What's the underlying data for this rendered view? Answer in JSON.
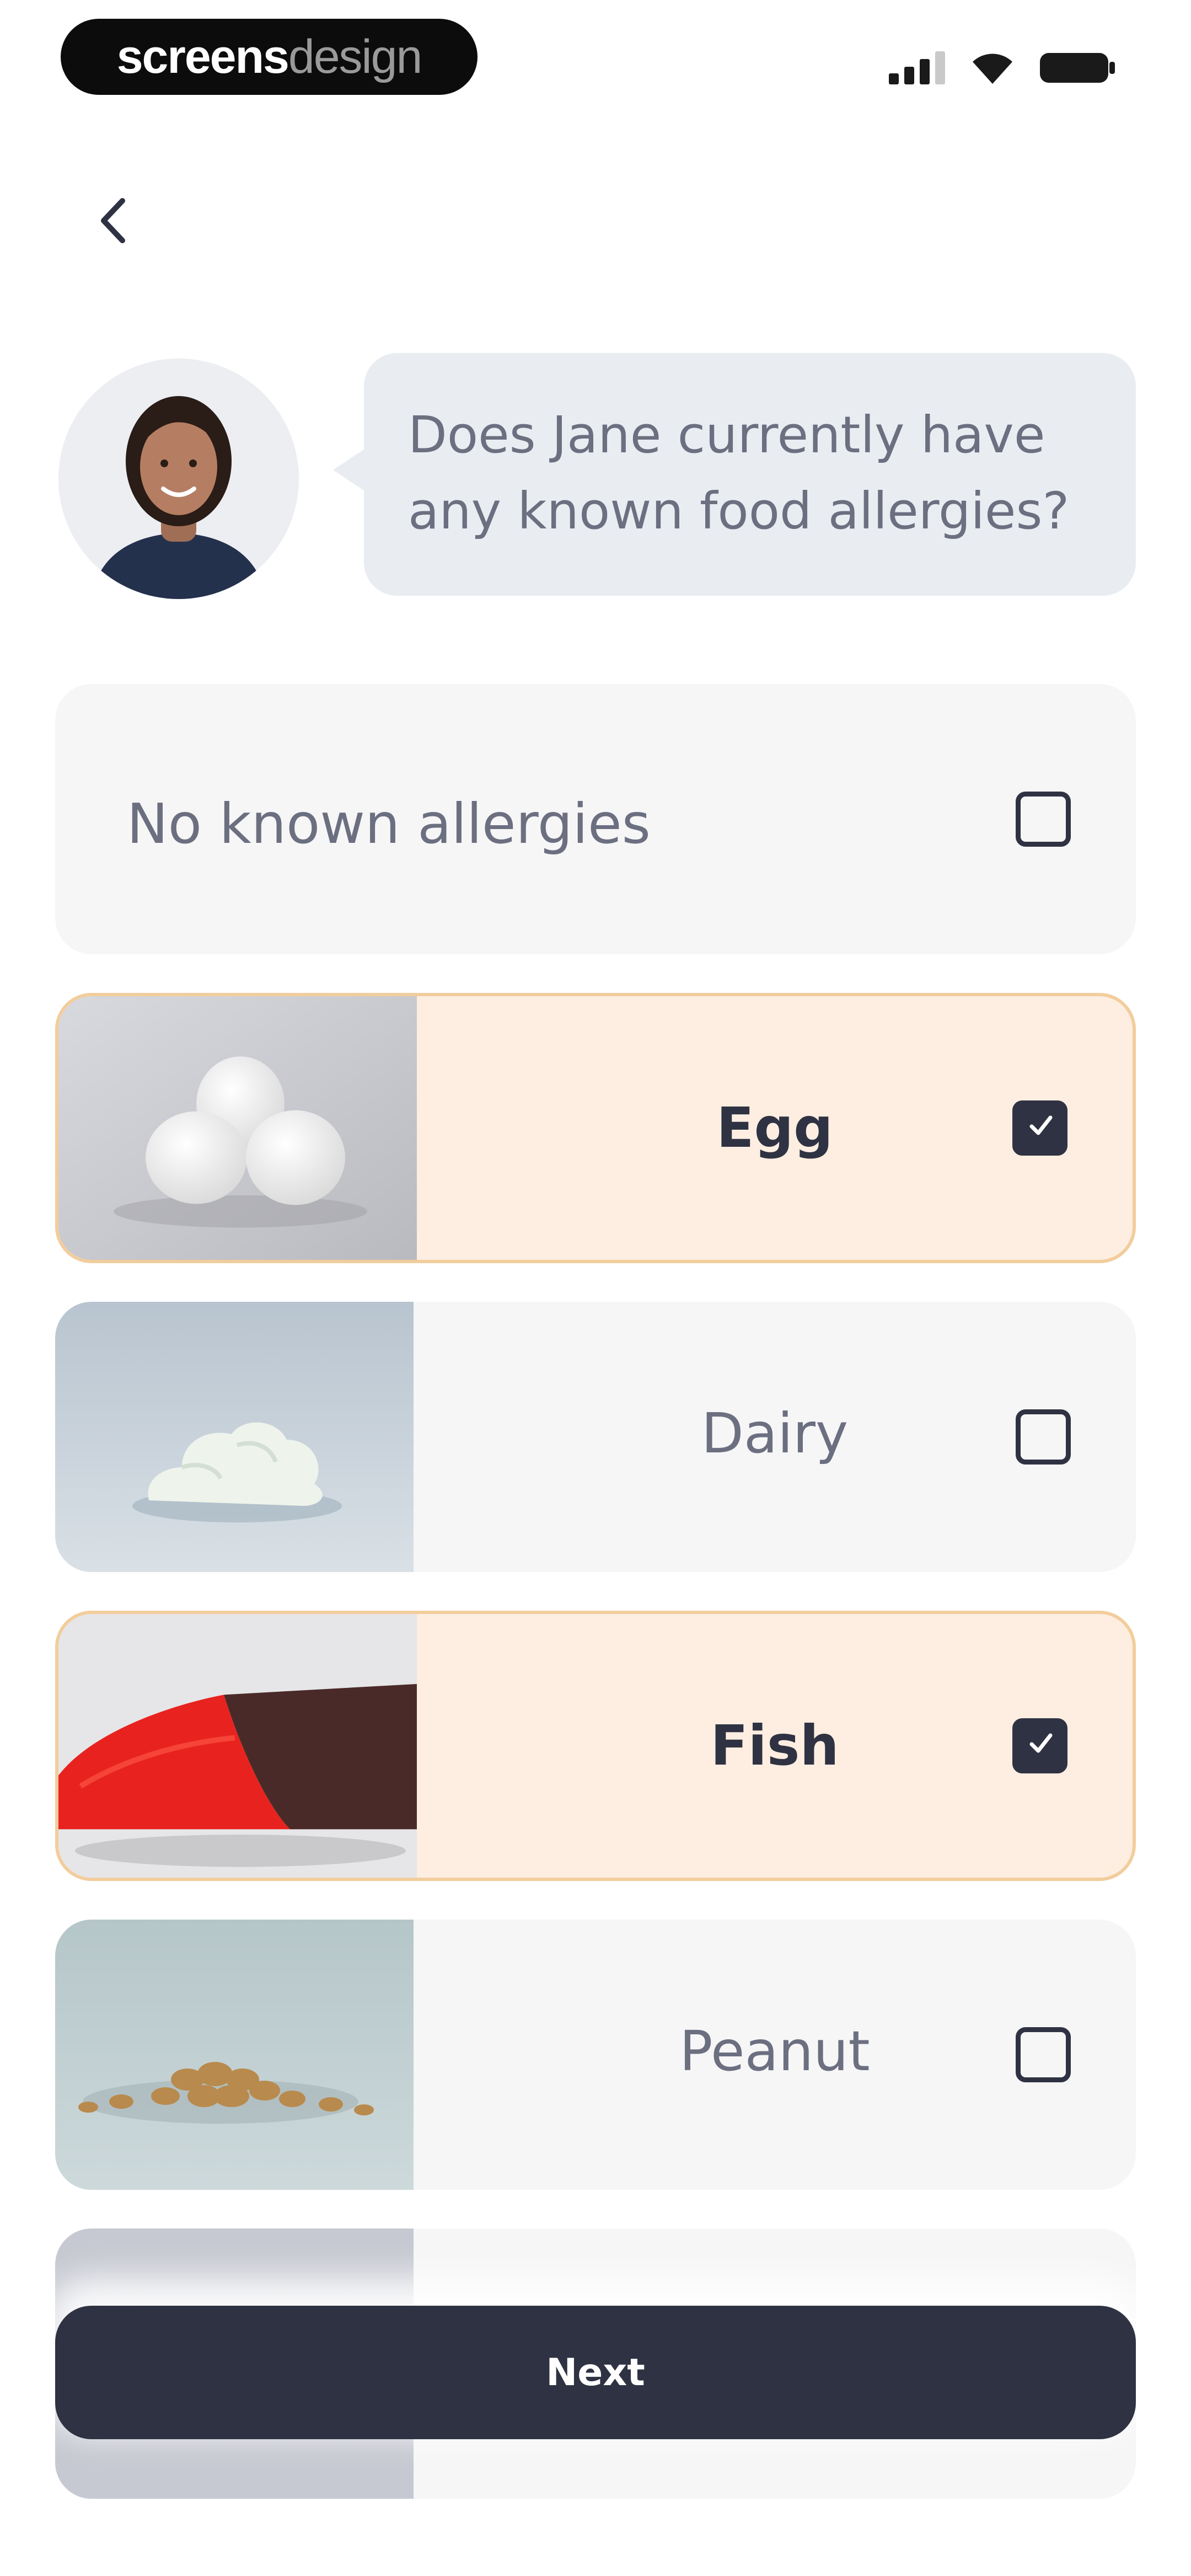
{
  "status_bar": {
    "brand_part1": "screens",
    "brand_part2": "design",
    "icons": [
      "signal-icon",
      "wifi-icon",
      "battery-icon"
    ]
  },
  "navigation": {
    "back_icon": "chevron-left-icon"
  },
  "question": {
    "text": "Does Jane currently have any known food allergies?",
    "avatar": "doctor-avatar"
  },
  "options": [
    {
      "label": "No known allergies",
      "checked": false,
      "image": null
    },
    {
      "label": "Egg",
      "checked": true,
      "image": "eggs-photo"
    },
    {
      "label": "Dairy",
      "checked": false,
      "image": "whipped-cream-photo"
    },
    {
      "label": "Fish",
      "checked": true,
      "image": "salmon-photo"
    },
    {
      "label": "Peanut",
      "checked": false,
      "image": "peanuts-photo"
    }
  ],
  "footer": {
    "next_label": "Next"
  },
  "colors": {
    "primary": "#2f3242",
    "selected_bg": "#fdeee1",
    "selected_border": "#f2cd9c",
    "card_bg": "#f6f6f7",
    "bubble_bg": "#e9edf2"
  }
}
